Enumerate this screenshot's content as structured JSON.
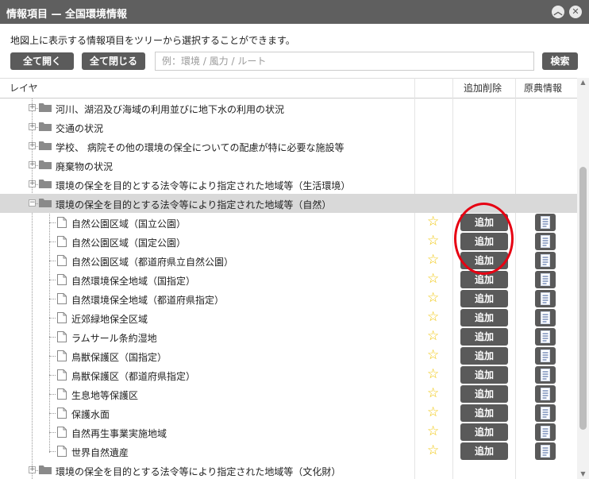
{
  "window": {
    "title": "情報項目 — 全国環境情報"
  },
  "description": "地図上に表示する情報項目をツリーから選択することができます。",
  "toolbar": {
    "expand_all": "全て開く",
    "collapse_all": "全て閉じる",
    "search_placeholder": "例：環境 / 風力 / ルート",
    "search_button": "検索"
  },
  "grid": {
    "col_layer": "レイヤ",
    "col_add_remove": "追加削除",
    "col_source": "原典情報"
  },
  "tree": {
    "folders_before": [
      "河川、湖沼及び海域の利用並びに地下水の利用の状況",
      "交通の状況",
      "学校、 病院その他の環境の保全についての配慮が特に必要な施設等",
      "廃棄物の状況",
      "環境の保全を目的とする法令等により指定された地域等（生活環境）"
    ],
    "expanded_folder": "環境の保全を目的とする法令等により指定された地域等（自然）",
    "children": [
      "自然公園区域（国立公園）",
      "自然公園区域（国定公園）",
      "自然公園区域（都道府県立自然公園）",
      "自然環境保全地域（国指定）",
      "自然環境保全地域（都道府県指定）",
      "近郊緑地保全区域",
      "ラムサール条約湿地",
      "鳥獣保護区（国指定）",
      "鳥獣保護区（都道府県指定）",
      "生息地等保護区",
      "保護水面",
      "自然再生事業実施地域",
      "世界自然遺産"
    ],
    "folders_after": [
      "環境の保全を目的とする法令等により指定された地域等（文化財）"
    ],
    "add_label": "追加"
  },
  "colors": {
    "titlebar": "#5f5f5f",
    "button": "#5a5a5a",
    "selected_row": "#d9d9d9",
    "star": "#f0c400",
    "highlight": "#e60012"
  },
  "icons": {
    "minimize": "chevron-up-icon",
    "close": "close-icon",
    "folder": "folder-icon",
    "leaf": "document-icon",
    "favorite": "star-icon",
    "source": "document-lines-icon"
  }
}
